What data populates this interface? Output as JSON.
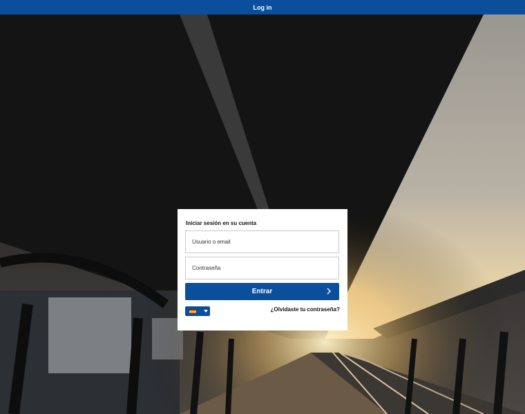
{
  "header": {
    "title": "Log in"
  },
  "login": {
    "heading": "Iniciar sesión en su cuenta",
    "username_placeholder": "Usuario o email",
    "password_placeholder": "Contraseña",
    "submit_label": "Entrar",
    "forgot_label": "¿Olvidaste tu contraseña?",
    "language_flag": "spain-flag-icon"
  },
  "colors": {
    "brand": "#0a4f9c",
    "card": "#ffffff"
  }
}
